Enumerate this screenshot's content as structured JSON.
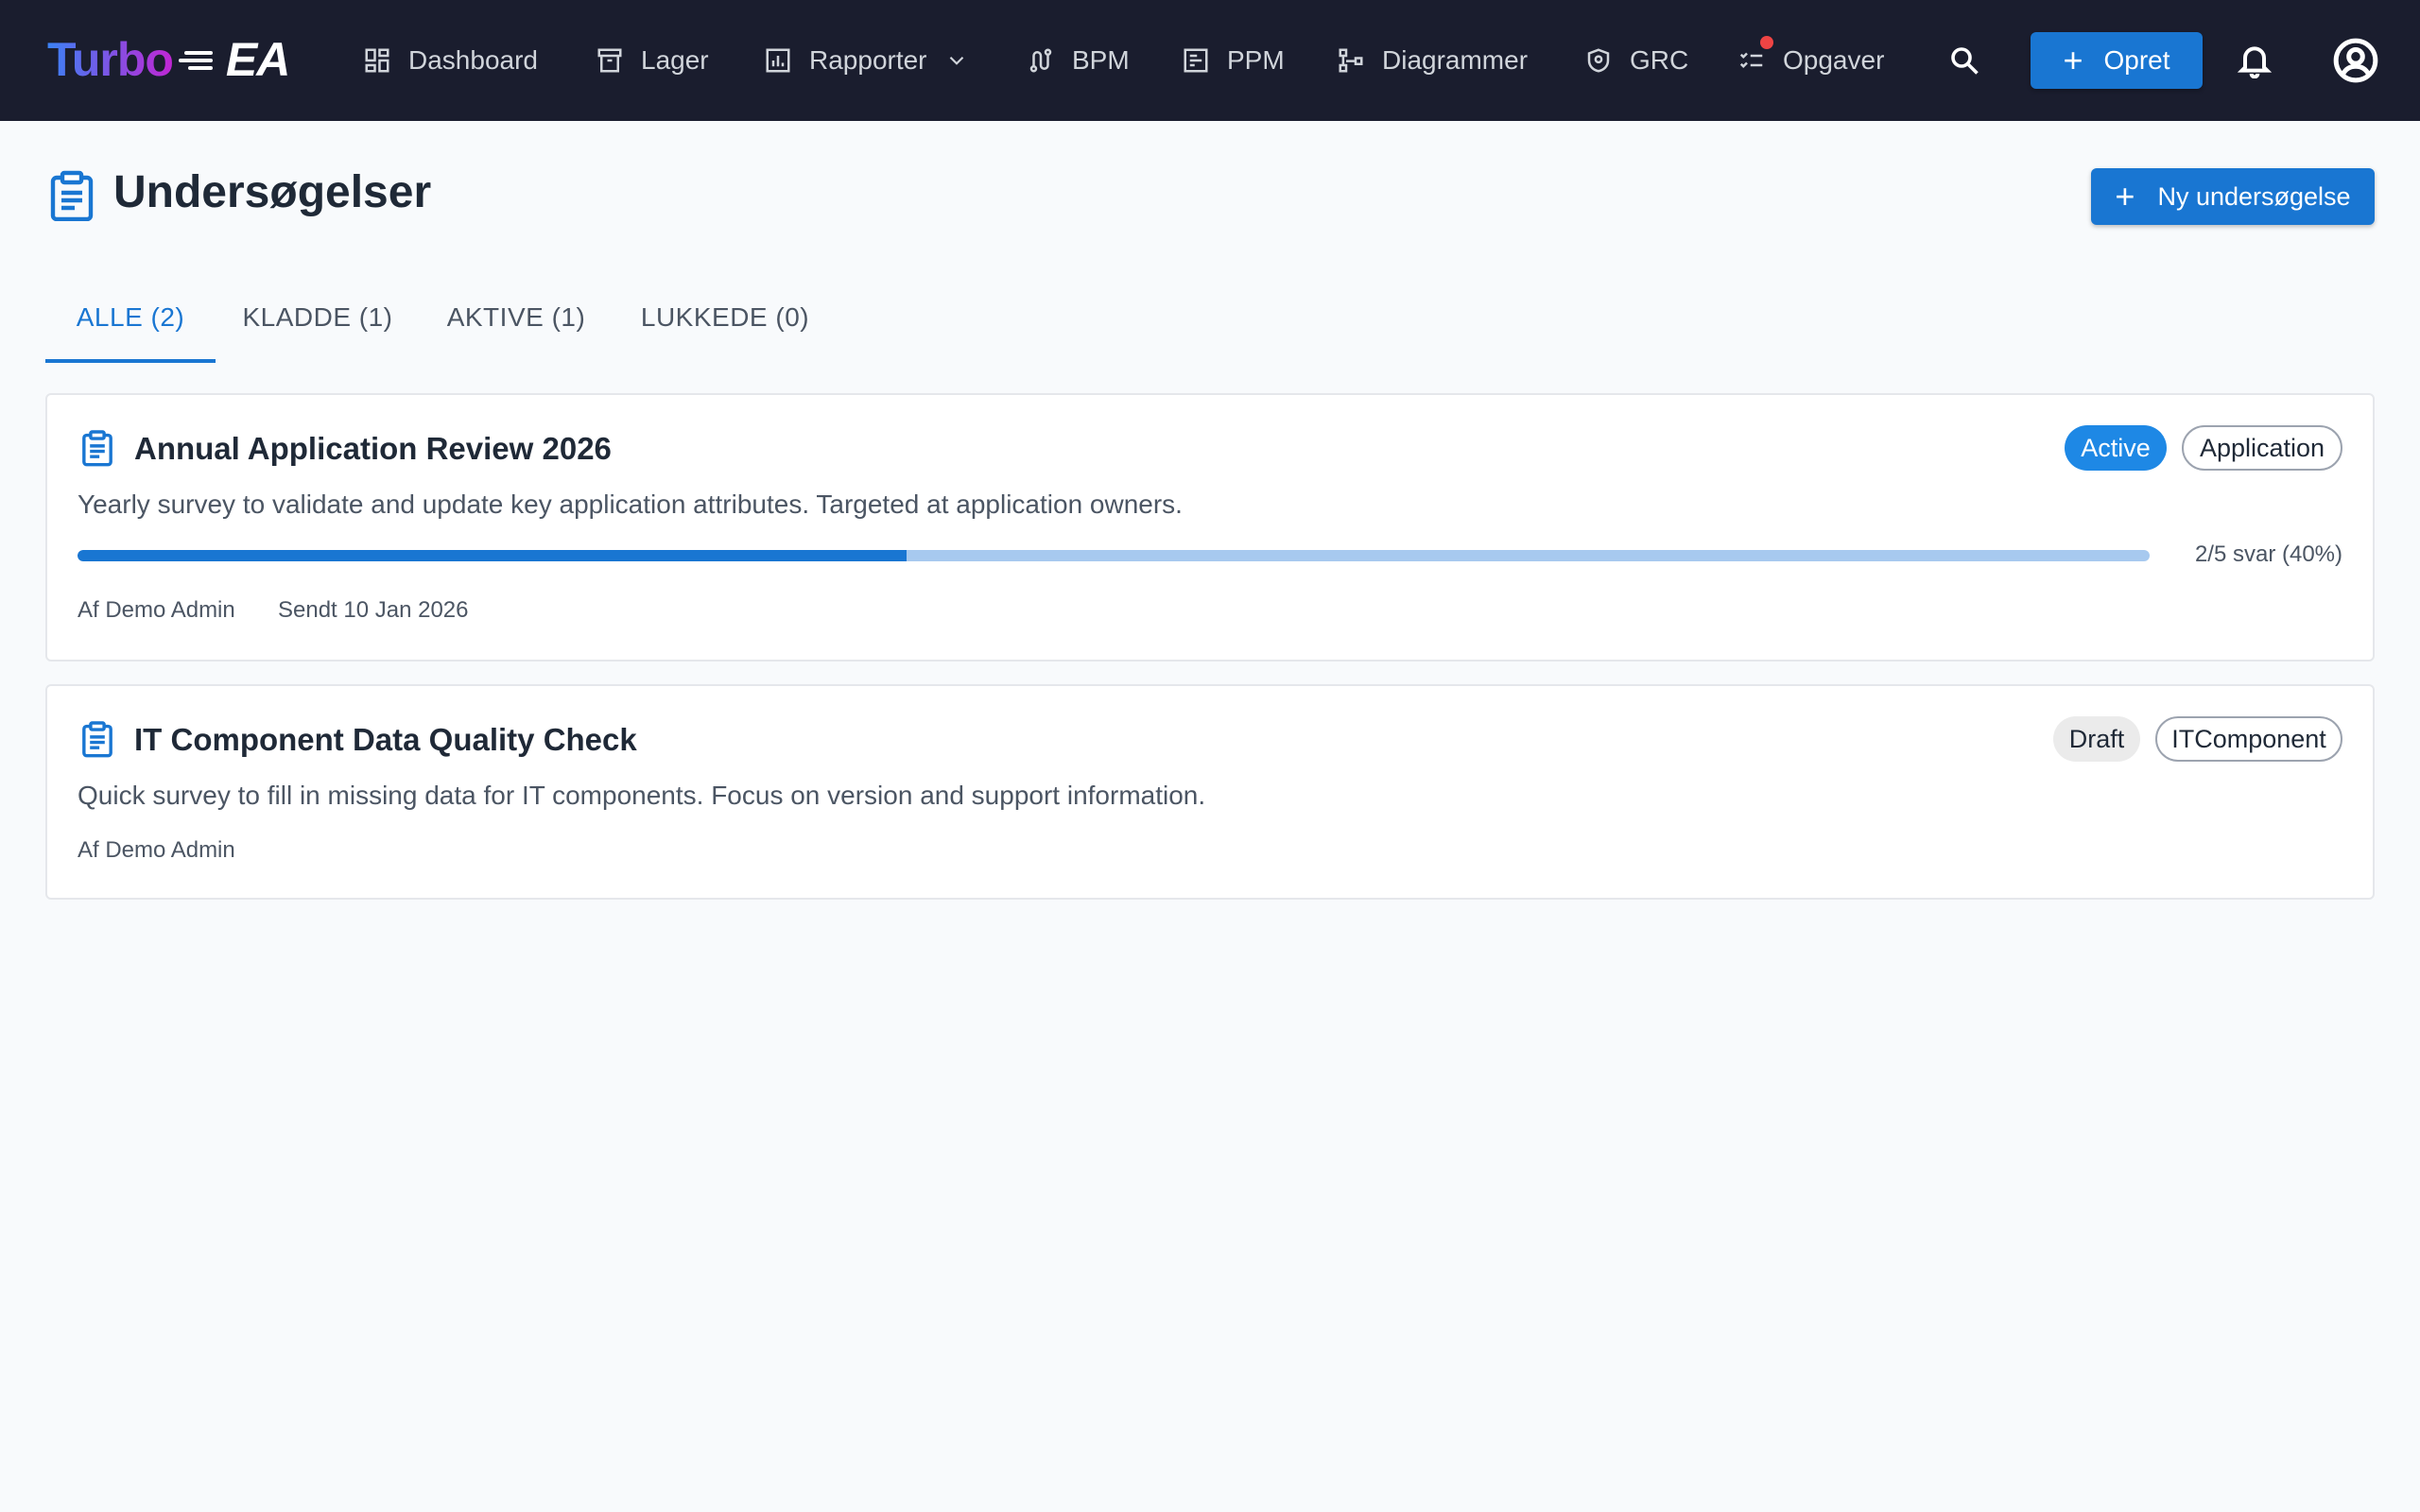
{
  "app": {
    "logo_part1": "Turbo",
    "logo_part2": "EA"
  },
  "nav": {
    "items": [
      {
        "label": "Dashboard",
        "icon": "dashboard-icon"
      },
      {
        "label": "Lager",
        "icon": "archive-icon"
      },
      {
        "label": "Rapporter",
        "icon": "report-icon"
      },
      {
        "label": "BPM",
        "icon": "route-icon"
      },
      {
        "label": "PPM",
        "icon": "project-icon"
      },
      {
        "label": "Diagrammer",
        "icon": "diagram-icon"
      },
      {
        "label": "GRC",
        "icon": "shield-icon"
      },
      {
        "label": "Opgaver",
        "icon": "tasks-icon"
      }
    ],
    "create_label": "Opret"
  },
  "page": {
    "title": "Undersøgelser",
    "new_button_label": "Ny undersøgelse"
  },
  "tabs": [
    {
      "label": "ALLE (2)",
      "active": true
    },
    {
      "label": "KLADDE (1)",
      "active": false
    },
    {
      "label": "AKTIVE (1)",
      "active": false
    },
    {
      "label": "LUKKEDE (0)",
      "active": false
    }
  ],
  "surveys": [
    {
      "title": "Annual Application Review 2026",
      "description": "Yearly survey to validate and update key application attributes. Targeted at application owners.",
      "status": "Active",
      "type": "Application",
      "progress_fraction": 0.4,
      "progress_label": "2/5 svar (40%)",
      "author": "Af Demo Admin",
      "sent": "Sendt 10 Jan 2026"
    },
    {
      "title": "IT Component Data Quality Check",
      "description": "Quick survey to fill in missing data for IT components. Focus on version and support information.",
      "status": "Draft",
      "type": "ITComponent",
      "author": "Af Demo Admin"
    }
  ],
  "colors": {
    "topbar": "#1a1d2e",
    "primary": "#1976d2",
    "notification": "#ef4444"
  }
}
